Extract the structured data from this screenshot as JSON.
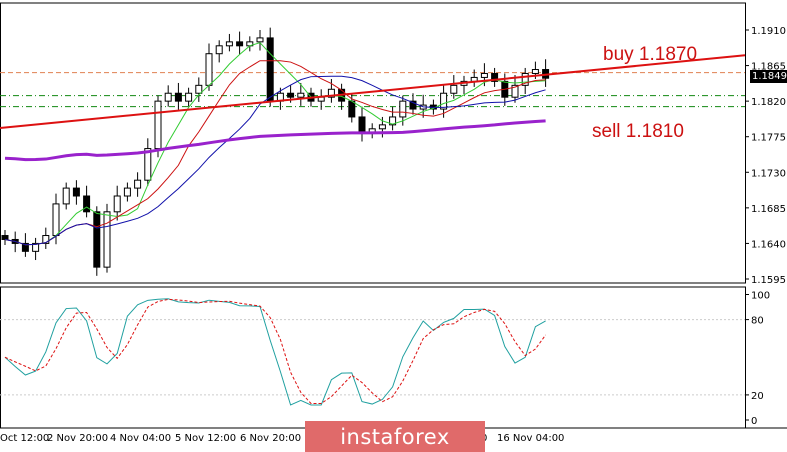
{
  "chart_data": {
    "type": "candlestick",
    "symbol_current_price": "1.1849",
    "price_axis": {
      "ticks": [
        "1.1910",
        "1.1865",
        "1.1820",
        "1.1775",
        "1.1730",
        "1.1685",
        "1.1640",
        "1.1595"
      ],
      "range": [
        1.1595,
        1.191
      ]
    },
    "oscillator_axis": {
      "ticks": [
        "100",
        "80",
        "20",
        "0"
      ],
      "range": [
        0,
        100
      ]
    },
    "time_labels": [
      "Oct 12:00",
      "2 Nov 20:00",
      "4 Nov 04:00",
      "5 Nov 12:00",
      "6 Nov 20:00",
      "0",
      "16 Nov 04:00"
    ],
    "closes": [
      1.1645,
      1.164,
      1.163,
      1.164,
      1.165,
      1.169,
      1.171,
      1.17,
      1.168,
      1.161,
      1.168,
      1.17,
      1.171,
      1.172,
      1.176,
      1.182,
      1.183,
      1.182,
      1.183,
      1.184,
      1.188,
      1.189,
      1.1895,
      1.189,
      1.1895,
      1.19,
      1.182,
      1.183,
      1.1825,
      1.183,
      1.182,
      1.1825,
      1.1835,
      1.182,
      1.18,
      1.178,
      1.1785,
      1.179,
      1.18,
      1.182,
      1.181,
      1.1815,
      1.181,
      1.183,
      1.184,
      1.1845,
      1.185,
      1.1855,
      1.1845,
      1.1825,
      1.184,
      1.1855,
      1.186,
      1.1849
    ],
    "trendline": {
      "start_price": 1.1786,
      "end_price": 1.1878,
      "color": "#dd1111"
    },
    "levels": [
      {
        "price": 1.1856,
        "color": "#e08050",
        "style": "dashed"
      },
      {
        "price": 1.1827,
        "color": "#118811",
        "style": "dashdot"
      },
      {
        "price": 1.1813,
        "color": "#118811",
        "style": "dashdot"
      }
    ],
    "annotations": {
      "buy": "buy 1.1870",
      "sell": "sell 1.1810"
    },
    "colors": {
      "ma_fast": "#33cc33",
      "ma_mid": "#cc1111",
      "ma_slow": "#1111aa",
      "ma_long": "#9922cc",
      "stoch_main": "#20a0a0",
      "stoch_signal": "#dd1111",
      "annotation": "#cc1111"
    }
  },
  "footer": {
    "logo": "instaforex"
  }
}
